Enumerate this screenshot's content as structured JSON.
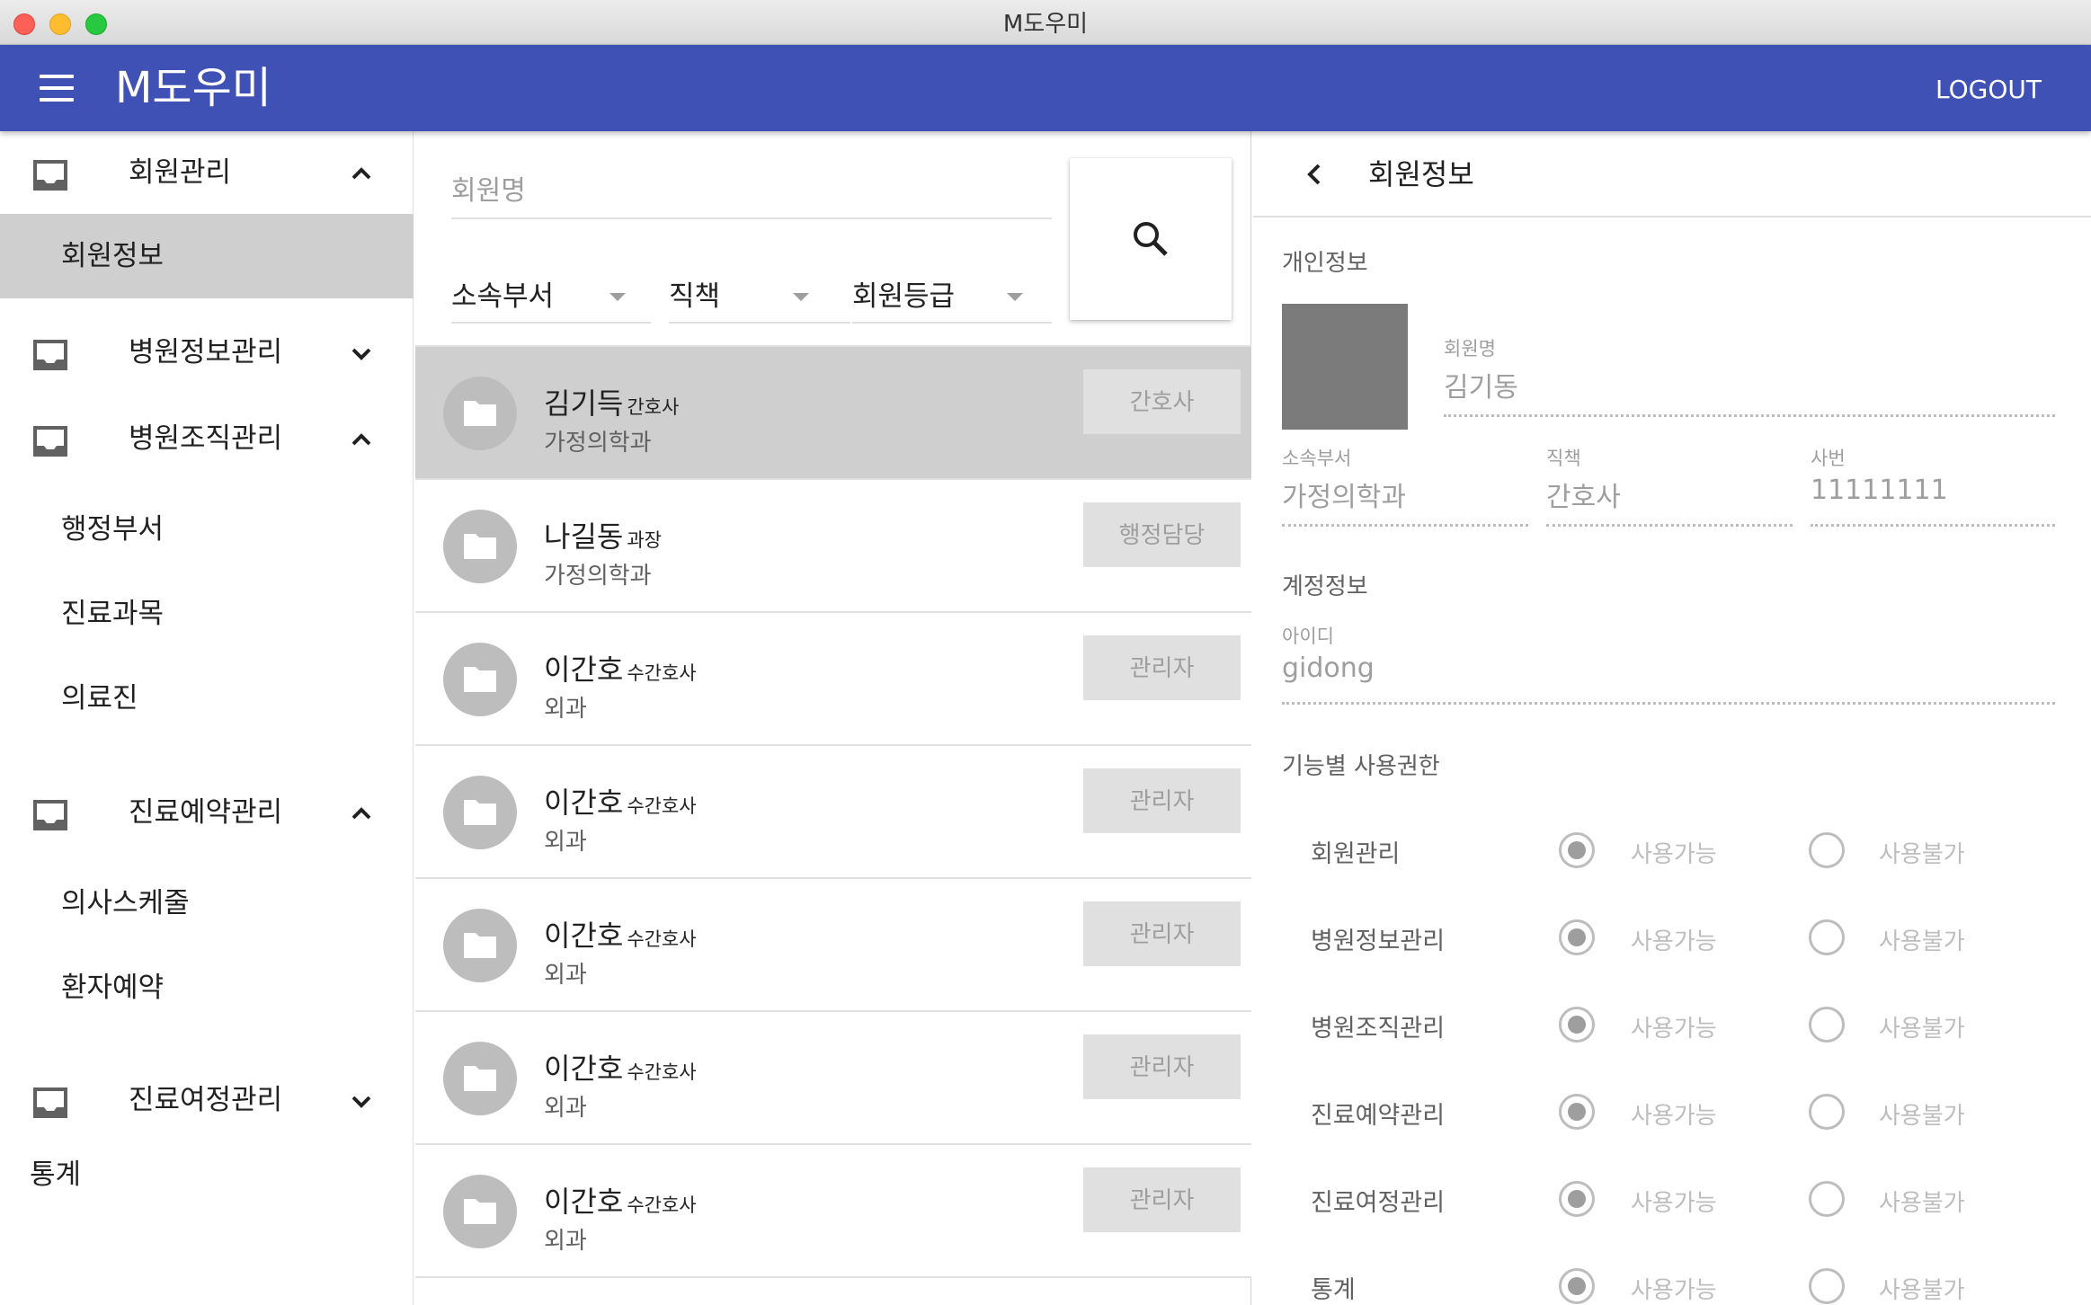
{
  "window": {
    "title": "M도우미"
  },
  "appbar": {
    "title": "M도우미",
    "logout_label": "LOGOUT",
    "color": "#3f51b5"
  },
  "sidebar": {
    "groups": [
      {
        "label": "회원관리",
        "expanded": true,
        "children": [
          {
            "label": "회원정보",
            "active": true
          }
        ]
      },
      {
        "label": "병원정보관리",
        "expanded": false,
        "children": []
      },
      {
        "label": "병원조직관리",
        "expanded": true,
        "children": [
          {
            "label": "행정부서"
          },
          {
            "label": "진료과목"
          },
          {
            "label": "의료진"
          }
        ]
      },
      {
        "label": "진료예약관리",
        "expanded": true,
        "children": [
          {
            "label": "의사스케줄"
          },
          {
            "label": "환자예약"
          }
        ]
      },
      {
        "label": "진료여정관리",
        "expanded": false,
        "children": []
      }
    ],
    "stats_label": "통계"
  },
  "search": {
    "placeholder": "회원명",
    "value": "",
    "filters": {
      "department": "소속부서",
      "position": "직책",
      "grade": "회원등급"
    }
  },
  "members": [
    {
      "name": "김기득",
      "position": "간호사",
      "department": "가정의학과",
      "grade": "간호사",
      "selected": true
    },
    {
      "name": "나길동",
      "position": "과장",
      "department": "가정의학과",
      "grade": "행정담당",
      "selected": false
    },
    {
      "name": "이간호",
      "position": "수간호사",
      "department": "외과",
      "grade": "관리자",
      "selected": false
    },
    {
      "name": "이간호",
      "position": "수간호사",
      "department": "외과",
      "grade": "관리자",
      "selected": false
    },
    {
      "name": "이간호",
      "position": "수간호사",
      "department": "외과",
      "grade": "관리자",
      "selected": false
    },
    {
      "name": "이간호",
      "position": "수간호사",
      "department": "외과",
      "grade": "관리자",
      "selected": false
    },
    {
      "name": "이간호",
      "position": "수간호사",
      "department": "외과",
      "grade": "관리자",
      "selected": false
    }
  ],
  "detail": {
    "title": "회원정보",
    "personal": {
      "section_title": "개인정보",
      "name_label": "회원명",
      "name_value": "김기동",
      "dept_label": "소속부서",
      "dept_value": "가정의학과",
      "position_label": "직책",
      "position_value": "간호사",
      "employee_no_label": "사번",
      "employee_no_value": "11111111"
    },
    "account": {
      "section_title": "계정정보",
      "id_label": "아이디",
      "id_value": "gidong"
    },
    "permissions": {
      "section_title": "기능별 사용권한",
      "allow_label": "사용가능",
      "deny_label": "사용불가",
      "items": [
        {
          "label": "회원관리",
          "allowed": true
        },
        {
          "label": "병원정보관리",
          "allowed": true
        },
        {
          "label": "병원조직관리",
          "allowed": true
        },
        {
          "label": "진료예약관리",
          "allowed": true
        },
        {
          "label": "진료여정관리",
          "allowed": true
        },
        {
          "label": "통계",
          "allowed": true
        }
      ]
    }
  }
}
